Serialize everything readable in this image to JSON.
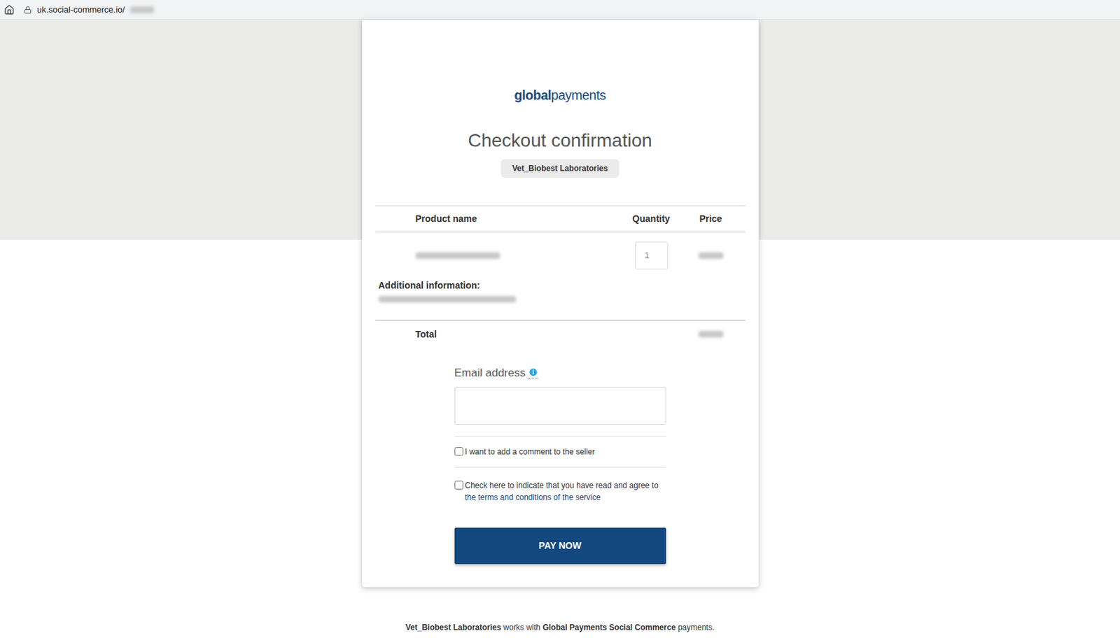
{
  "browser": {
    "address": "uk.social-commerce.io/",
    "address_blurred": true
  },
  "logo": {
    "bold": "global",
    "light": "payments"
  },
  "title": "Checkout confirmation",
  "merchant": "Vet_Biobest Laboratories",
  "table": {
    "columns": [
      "Product name",
      "Quantity",
      "Price"
    ],
    "rows": [
      {
        "name_blurred": true,
        "quantity": "1",
        "price_blurred": true
      }
    ]
  },
  "additional_info": {
    "label": "Additional information:",
    "value_blurred": true
  },
  "total": {
    "label": "Total",
    "value_blurred": true
  },
  "email": {
    "label": "Email address",
    "value": ""
  },
  "checkboxes": [
    {
      "label": "I want to add a comment to the seller",
      "link": "",
      "checked": false
    },
    {
      "label": "Check here to indicate that you have read and agree to ",
      "link": "the terms and conditions of the service",
      "checked": false
    }
  ],
  "pay_button": "PAY NOW",
  "footer": [
    {
      "text": "Vet_Biobest Laboratories",
      "bold": true
    },
    {
      "text": " works with ",
      "bold": false
    },
    {
      "text": "Global Payments Social Commerce",
      "bold": true
    },
    {
      "text": " payments.",
      "bold": false
    }
  ]
}
